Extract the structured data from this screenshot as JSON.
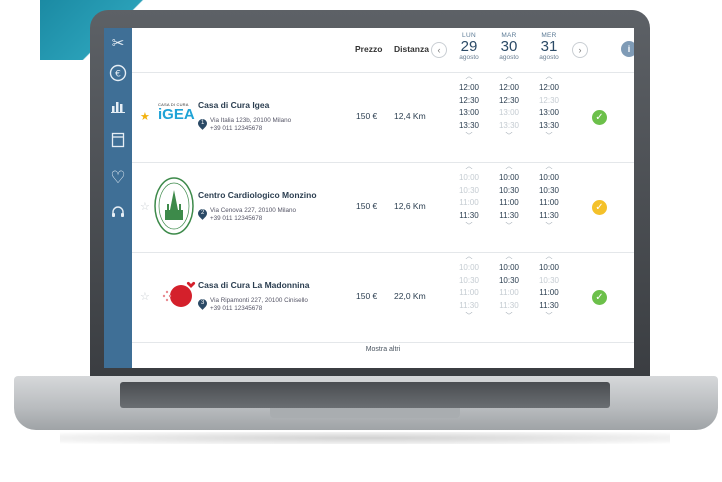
{
  "header": {
    "price_label": "Prezzo",
    "distance_label": "Distanza",
    "prev_label": "‹",
    "next_label": "›",
    "info_label": "i",
    "days": [
      {
        "name": "LUN",
        "num": "29",
        "month": "agosto"
      },
      {
        "name": "MAR",
        "num": "30",
        "month": "agosto"
      },
      {
        "name": "MER",
        "num": "31",
        "month": "agosto"
      }
    ]
  },
  "sidebar": {
    "icons": [
      "scissors-icon",
      "euro-icon",
      "chart-icon",
      "document-icon",
      "heart-icon",
      "headset-icon"
    ]
  },
  "clinics": [
    {
      "name": "Casa di Cura Igea",
      "logo_text_small": "CASA DI CURA",
      "logo_text": "iGEA",
      "pin": "1",
      "address": "Via Italia 123b, 20100 Milano",
      "phone": "+39 011 12345678",
      "price": "150 €",
      "distance": "12,4 Km",
      "favorite": true,
      "slots": [
        [
          {
            "t": "12:00",
            "on": true
          },
          {
            "t": "12:30",
            "on": true
          },
          {
            "t": "13:00",
            "on": true
          },
          {
            "t": "13:30",
            "on": true
          }
        ],
        [
          {
            "t": "12:00",
            "on": true
          },
          {
            "t": "12:30",
            "on": true
          },
          {
            "t": "13:00",
            "on": false
          },
          {
            "t": "13:30",
            "on": false
          }
        ],
        [
          {
            "t": "12:00",
            "on": true
          },
          {
            "t": "12:30",
            "on": false
          },
          {
            "t": "13:00",
            "on": true
          },
          {
            "t": "13:30",
            "on": true
          }
        ]
      ],
      "status_color": "#6cc04a"
    },
    {
      "name": "Centro Cardiologico Monzino",
      "pin": "2",
      "address": "Via Cenova 227, 20100 Milano",
      "phone": "+39 011 12345678",
      "price": "150 €",
      "distance": "12,6 Km",
      "favorite": false,
      "slots": [
        [
          {
            "t": "10:00",
            "on": false
          },
          {
            "t": "10:30",
            "on": false
          },
          {
            "t": "11:00",
            "on": false
          },
          {
            "t": "11:30",
            "on": true
          }
        ],
        [
          {
            "t": "10:00",
            "on": true
          },
          {
            "t": "10:30",
            "on": true
          },
          {
            "t": "11:00",
            "on": true
          },
          {
            "t": "11:30",
            "on": true
          }
        ],
        [
          {
            "t": "10:00",
            "on": true
          },
          {
            "t": "10:30",
            "on": true
          },
          {
            "t": "11:00",
            "on": true
          },
          {
            "t": "11:30",
            "on": true
          }
        ]
      ],
      "status_color": "#f4c12a"
    },
    {
      "name": "Casa di Cura La Madonnina",
      "pin": "3",
      "address": "Via Ripamonti 227, 20100 Cinisello",
      "phone": "+39 011 12345678",
      "price": "150 €",
      "distance": "22,0 Km",
      "favorite": false,
      "slots": [
        [
          {
            "t": "10:00",
            "on": false
          },
          {
            "t": "10:30",
            "on": false
          },
          {
            "t": "11:00",
            "on": false
          },
          {
            "t": "11:30",
            "on": false
          }
        ],
        [
          {
            "t": "10:00",
            "on": true
          },
          {
            "t": "10:30",
            "on": true
          },
          {
            "t": "11:00",
            "on": false
          },
          {
            "t": "11:30",
            "on": false
          }
        ],
        [
          {
            "t": "10:00",
            "on": true
          },
          {
            "t": "10:30",
            "on": false
          },
          {
            "t": "11:00",
            "on": true
          },
          {
            "t": "11:30",
            "on": true
          }
        ]
      ],
      "status_color": "#6cc04a"
    }
  ],
  "show_more": "Mostra altri",
  "colors": {
    "accent": "#3f6f96",
    "teal": "#1f8fa8"
  }
}
